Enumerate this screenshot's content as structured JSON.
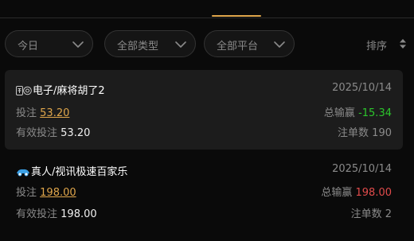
{
  "filters": {
    "date": "今日",
    "type": "全部类型",
    "platform": "全部平台",
    "sort_label": "排序"
  },
  "records": [
    {
      "icon": "mahjong-icon",
      "title": "电子/麻将胡了2",
      "date": "2025/10/14",
      "bet_label": "投注",
      "bet": "53.20",
      "winloss_label": "总输赢",
      "winloss": "-15.34",
      "winloss_color": "#2cc52c",
      "valid_label": "有效投注",
      "valid": "53.20",
      "count_label": "注单数",
      "count": "190"
    },
    {
      "icon": "live-casino-icon",
      "title": "真人/视讯极速百家乐",
      "date": "2025/10/14",
      "bet_label": "投注",
      "bet": "198.00",
      "winloss_label": "总输赢",
      "winloss": "198.00",
      "winloss_color": "#e14b4b",
      "valid_label": "有效投注",
      "valid": "198.00",
      "count_label": "注单数",
      "count": "2"
    }
  ]
}
